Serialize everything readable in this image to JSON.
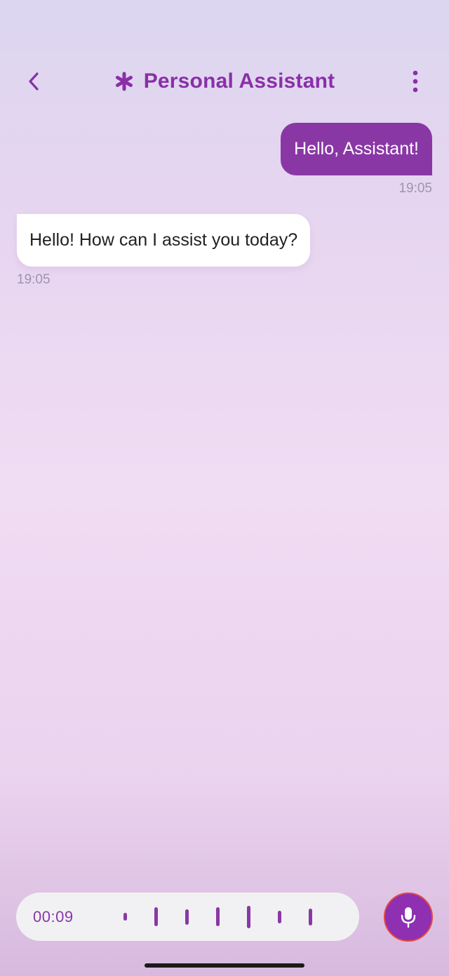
{
  "header": {
    "title": "Personal Assistant",
    "back_icon": "chevron-left-icon",
    "title_icon": "asterisk-icon",
    "more_icon": "more-vertical-icon",
    "accent_color": "#8a2fa8"
  },
  "messages": [
    {
      "sender": "user",
      "text": "Hello, Assistant!",
      "time": "19:05"
    },
    {
      "sender": "assistant",
      "text": "Hello! How can I assist you today?",
      "time": "19:05"
    }
  ],
  "recording": {
    "elapsed": "00:09",
    "mic_icon": "microphone-icon",
    "bar_color": "#8a37a6",
    "levels": [
      0.35,
      0.85,
      0.7,
      0.85,
      1.0,
      0.55,
      0.75
    ]
  }
}
